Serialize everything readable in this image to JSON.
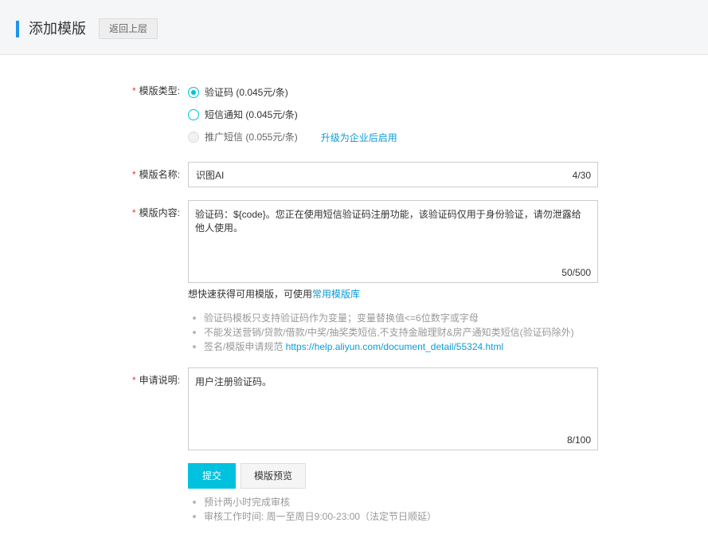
{
  "header": {
    "title": "添加模版",
    "back_label": "返回上层"
  },
  "template_type": {
    "label": "模版类型:",
    "options": [
      {
        "label": "验证码 (0.045元/条)",
        "state": "checked"
      },
      {
        "label": "短信通知 (0.045元/条)",
        "state": "unchecked"
      },
      {
        "label": "推广短信 (0.055元/条)",
        "state": "disabled"
      }
    ],
    "upgrade_link": "升级为企业后启用"
  },
  "template_name": {
    "label": "模版名称:",
    "value": "识图AI",
    "count": "4/30"
  },
  "template_content": {
    "label": "模版内容:",
    "value": "验证码：${code}。您正在使用短信验证码注册功能，该验证码仅用于身份验证，请勿泄露给他人使用。",
    "count": "50/500"
  },
  "hint": {
    "text": "想快速获得可用模版，可使用",
    "link": "常用模版库"
  },
  "notes": [
    {
      "text": "验证码模板只支持验证码作为变量；变量替换值<=6位数字或字母"
    },
    {
      "text": "不能发送营销/贷款/借款/中奖/抽奖类短信,不支持金融理财&房产通知类短信(验证码除外)"
    },
    {
      "text": "签名/模版申请规范 ",
      "link": "https://help.aliyun.com/document_detail/55324.html"
    }
  ],
  "application_note": {
    "label": "申请说明:",
    "value": "用户注册验证码。",
    "count": "8/100"
  },
  "buttons": {
    "submit": "提交",
    "preview": "模版预览"
  },
  "review_notes": [
    "预计两小时完成审核",
    "审核工作时间: 周一至周日9:00-23:00（法定节日顺延）"
  ],
  "colors": {
    "accent": "#00c1de",
    "link": "#0a9bd8",
    "required": "#e4393c",
    "header_bar": "#1f93ea"
  }
}
